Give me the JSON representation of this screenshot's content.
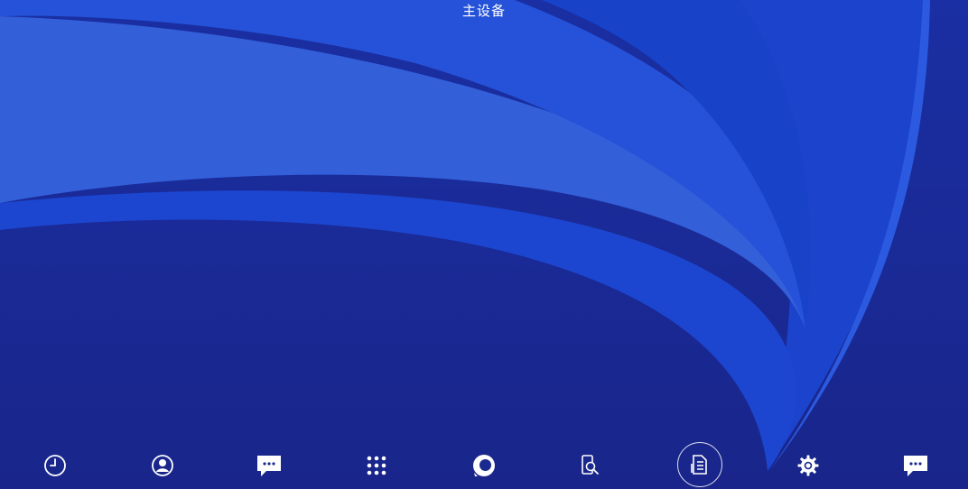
{
  "screen": {
    "title": "主设备",
    "accent": "#ffffff",
    "background": "#1b2a8f"
  },
  "dock": {
    "items": [
      {
        "icon": "clock-icon",
        "action": "recents"
      },
      {
        "icon": "person-icon",
        "action": "contacts"
      },
      {
        "icon": "chat-bubble-icon",
        "action": "messages"
      },
      {
        "icon": "app-grid-icon",
        "action": "apps"
      },
      {
        "icon": "ring-icon",
        "action": "orbit"
      },
      {
        "icon": "phone-search-icon",
        "action": "device-search"
      },
      {
        "icon": "document-icon",
        "action": "documents",
        "active": true
      },
      {
        "icon": "gear-icon",
        "action": "settings"
      },
      {
        "icon": "chat-bubble-icon",
        "action": "feedback"
      }
    ]
  }
}
